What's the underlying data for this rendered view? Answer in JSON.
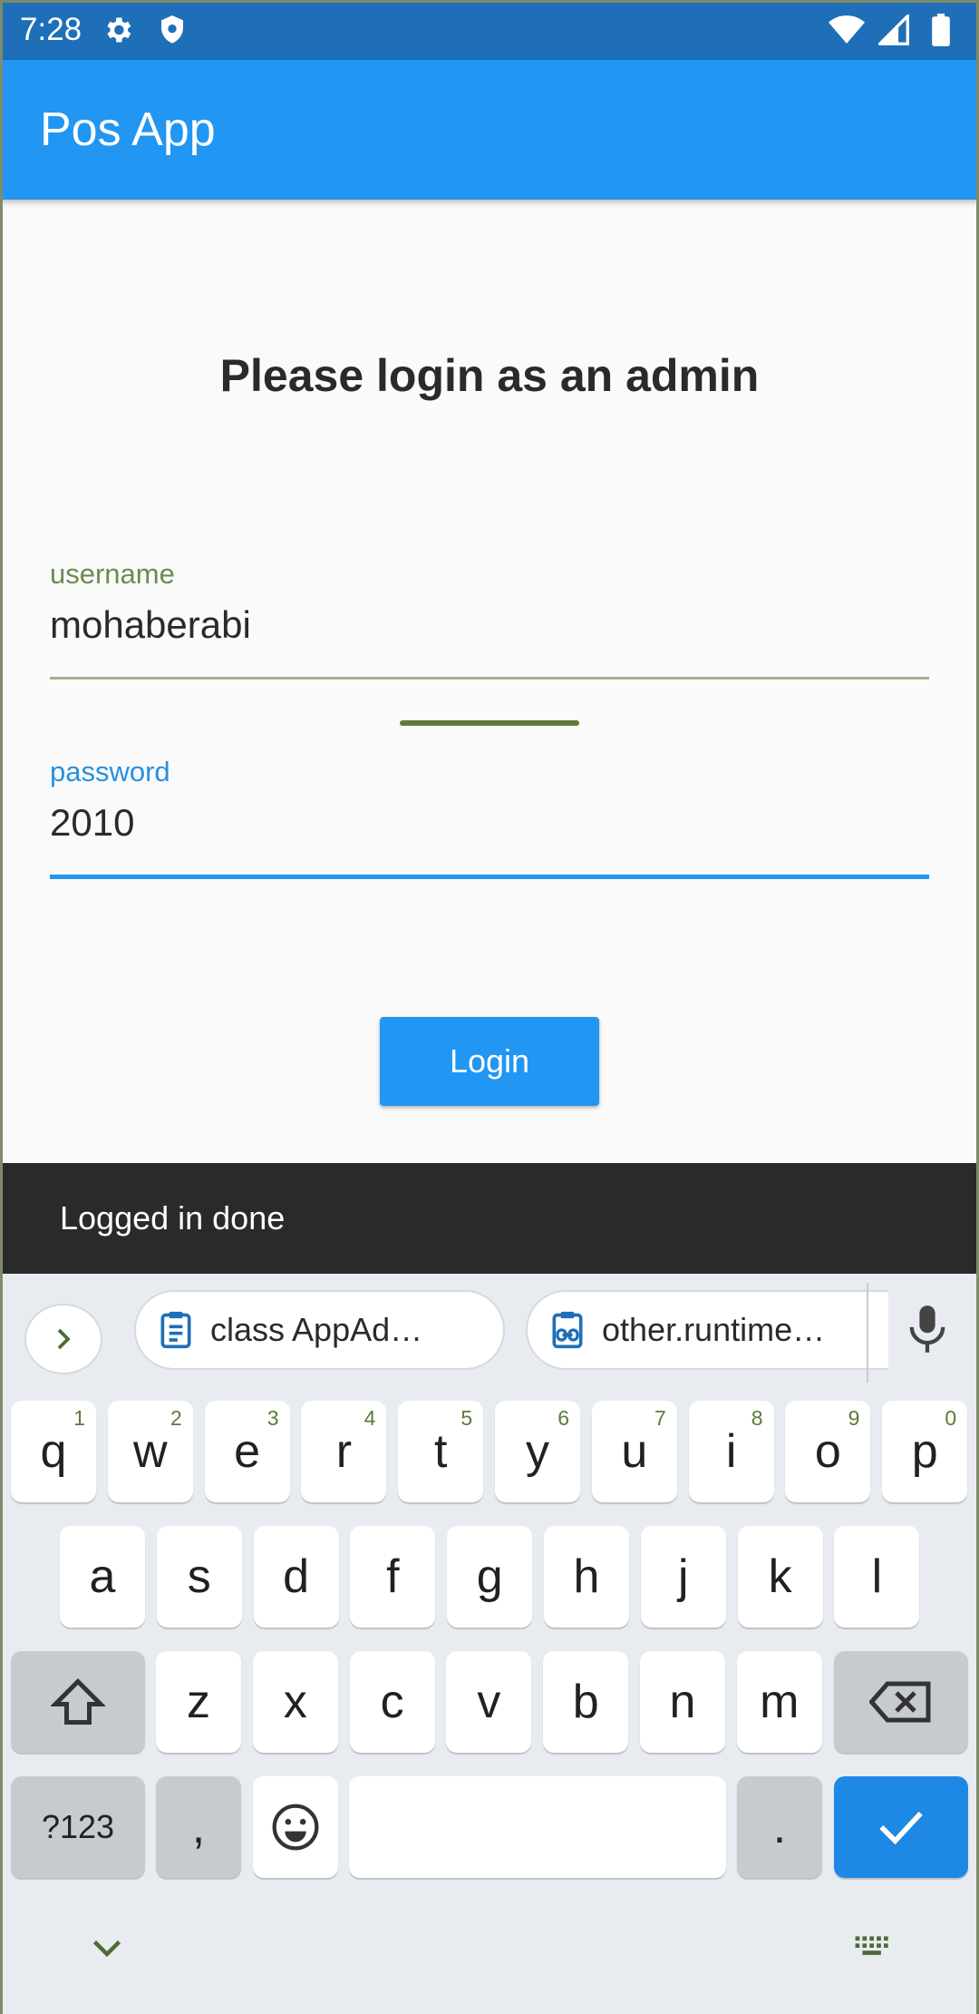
{
  "status_bar": {
    "time": "7:28",
    "icons_left": [
      "settings-icon",
      "shield-icon"
    ],
    "icons_right": [
      "wifi-icon",
      "signal-icon",
      "battery-icon"
    ]
  },
  "app_bar": {
    "title": "Pos App"
  },
  "login": {
    "heading": "Please login as an admin",
    "username": {
      "label": "username",
      "value": "mohaberabi"
    },
    "password": {
      "label": "password",
      "value": "2010"
    },
    "button_label": "Login"
  },
  "snackbar": {
    "message": "Logged in done"
  },
  "keyboard": {
    "suggestions": [
      {
        "icon": "clipboard-icon",
        "text": "class AppAd…"
      },
      {
        "icon": "clipboard-link-icon",
        "text": "other.runtime…"
      }
    ],
    "row1": [
      {
        "k": "q",
        "h": "1"
      },
      {
        "k": "w",
        "h": "2"
      },
      {
        "k": "e",
        "h": "3"
      },
      {
        "k": "r",
        "h": "4"
      },
      {
        "k": "t",
        "h": "5"
      },
      {
        "k": "y",
        "h": "6"
      },
      {
        "k": "u",
        "h": "7"
      },
      {
        "k": "i",
        "h": "8"
      },
      {
        "k": "o",
        "h": "9"
      },
      {
        "k": "p",
        "h": "0"
      }
    ],
    "row2": [
      "a",
      "s",
      "d",
      "f",
      "g",
      "h",
      "j",
      "k",
      "l"
    ],
    "row3": [
      "z",
      "x",
      "c",
      "v",
      "b",
      "n",
      "m"
    ],
    "symbols_label": "?123",
    "comma": ",",
    "period": ".",
    "accent_color": "#1e88e5"
  },
  "colors": {
    "status_bar": "#1e6fb8",
    "app_bar": "#2196f3",
    "snackbar": "#2a2a2a",
    "username_label": "#6f8a50",
    "password_label": "#2890e0"
  }
}
